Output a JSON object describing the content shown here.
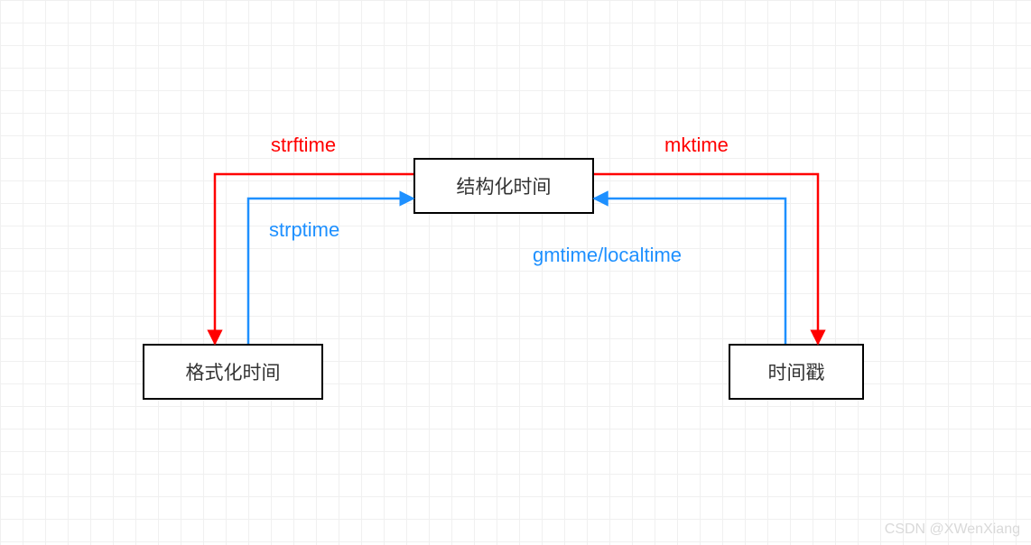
{
  "nodes": {
    "top": {
      "label": "结构化时间"
    },
    "left": {
      "label": "格式化时间"
    },
    "right": {
      "label": "时间戳"
    }
  },
  "edges": {
    "strftime": {
      "label": "strftime"
    },
    "strptime": {
      "label": "strptime"
    },
    "mktime": {
      "label": "mktime"
    },
    "gmtime": {
      "label": "gmtime/localtime"
    }
  },
  "watermark": "CSDN @XWenXiang"
}
